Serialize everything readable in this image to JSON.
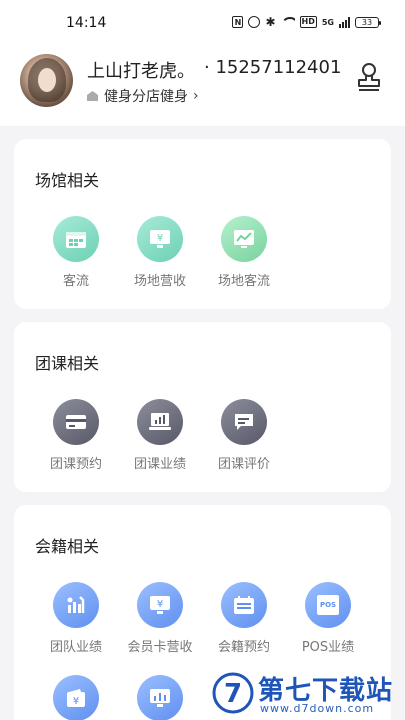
{
  "status_bar": {
    "time": "14:14",
    "nfc": "N",
    "hd": "HD",
    "network": "5G",
    "battery": "33"
  },
  "profile": {
    "name": "上山打老虎。",
    "phone": "· 15257112401",
    "store": "健身分店健身",
    "chevron": "›"
  },
  "sections": [
    {
      "title": "场馆相关",
      "items": [
        {
          "label": "客流",
          "icon": "calendar-icon"
        },
        {
          "label": "场地营收",
          "icon": "yen-monitor-icon"
        },
        {
          "label": "场地客流",
          "icon": "trend-chart-icon"
        }
      ]
    },
    {
      "title": "团课相关",
      "items": [
        {
          "label": "团课预约",
          "icon": "card-icon"
        },
        {
          "label": "团课业绩",
          "icon": "laptop-chart-icon"
        },
        {
          "label": "团课评价",
          "icon": "comment-icon"
        }
      ]
    },
    {
      "title": "会籍相关",
      "items": [
        {
          "label": "团队业绩",
          "icon": "team-bar-icon"
        },
        {
          "label": "会员卡营收",
          "icon": "yen-monitor-icon"
        },
        {
          "label": "会籍预约",
          "icon": "calendar-icon"
        },
        {
          "label": "POS业绩",
          "icon": "pos-icon",
          "glyph": "POS"
        },
        {
          "label": "",
          "icon": "yen-wallet-icon"
        },
        {
          "label": "",
          "icon": "bar-monitor-icon"
        }
      ]
    }
  ],
  "watermark": {
    "brand": "第七下载站",
    "url": "www.d7down.com",
    "logo_letter": "7"
  },
  "colors": {
    "green": "#6cd0b3",
    "gray": "#575968",
    "blue": "#5f8ff0",
    "watermark": "#1f55b8"
  }
}
